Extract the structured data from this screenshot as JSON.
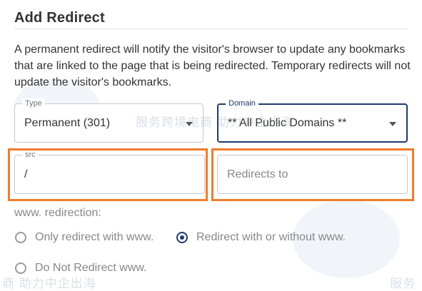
{
  "header": {
    "title": "Add Redirect"
  },
  "description": "A permanent redirect will notify the visitor's browser to update any bookmarks that are linked to the page that is being redirected. Temporary redirects will not update the visitor's bookmarks.",
  "type_select": {
    "label": "Type",
    "value": "Permanent (301)"
  },
  "domain_select": {
    "label": "Domain",
    "value": "** All Public Domains **"
  },
  "src_input": {
    "label": "src",
    "value": "/"
  },
  "redirects_to_input": {
    "placeholder": "Redirects to"
  },
  "www_redirection": {
    "label": "www. redirection:",
    "options": [
      {
        "label": "Only redirect with www.",
        "selected": false
      },
      {
        "label": "Redirect with or without www.",
        "selected": true
      },
      {
        "label": "Do Not Redirect www.",
        "selected": false
      }
    ]
  },
  "watermark": {
    "text1": "服务跨境电商 助力中企出海",
    "text2": "商 助力中企出海",
    "text3": "服务"
  },
  "colors": {
    "accent": "#1f3a6e",
    "highlight": "#f07c2c"
  }
}
